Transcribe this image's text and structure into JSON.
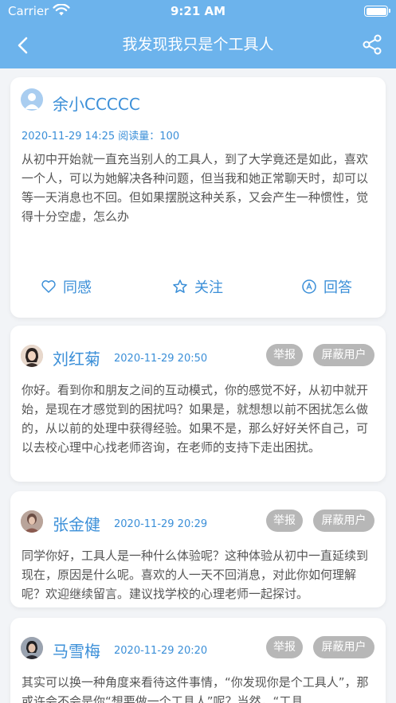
{
  "status_bar": {
    "carrier": "Carrier",
    "time": "9:21 AM"
  },
  "nav": {
    "title": "我发现我只是个工具人"
  },
  "question": {
    "author": "余小CCCCC",
    "meta": "2020-11-29 14:25 阅读量：100",
    "body": "从初中开始就一直充当别人的工具人，到了大学竟还是如此，喜欢一个人，可以为她解决各种问题，但当我和她正常聊天时，却可以等一天消息也不回。但如果摆脱这种关系，又会产生一种惯性，觉得十分空虚，怎么办",
    "actions": {
      "agree": "同感",
      "follow": "关注",
      "answer": "回答"
    }
  },
  "answers": [
    {
      "author": "刘红菊",
      "time": "2020-11-29 20:50",
      "report": "举报",
      "block": "屏蔽用户",
      "body": "你好。看到你和朋友之间的互动模式，你的感觉不好，从初中就开始，是现在才感觉到的困扰吗？如果是，就想想以前不困扰怎么做的，从以前的处理中获得经验。如果不是，那么好好关怀自己，可以去校心理中心找老师咨询，在老师的支持下走出困扰。"
    },
    {
      "author": "张金健",
      "time": "2020-11-29 20:29",
      "report": "举报",
      "block": "屏蔽用户",
      "body": "同学你好，工具人是一种什么体验呢？这种体验从初中一直延续到现在，原因是什么呢。喜欢的人一天不回消息，对此你如何理解呢？欢迎继续留言。建议找学校的心理老师一起探讨。"
    },
    {
      "author": "马雪梅",
      "time": "2020-11-29 20:20",
      "report": "举报",
      "block": "屏蔽用户",
      "body": "其实可以换一种角度来看待这件事情，“你发现你是个工具人”，那或许会不会是你“想要做一个工具人”呢？当然，“工具"
    }
  ],
  "colors": {
    "header": "#6cb3ec",
    "accent": "#3b8fd8",
    "pill": "#b7b7b7"
  }
}
